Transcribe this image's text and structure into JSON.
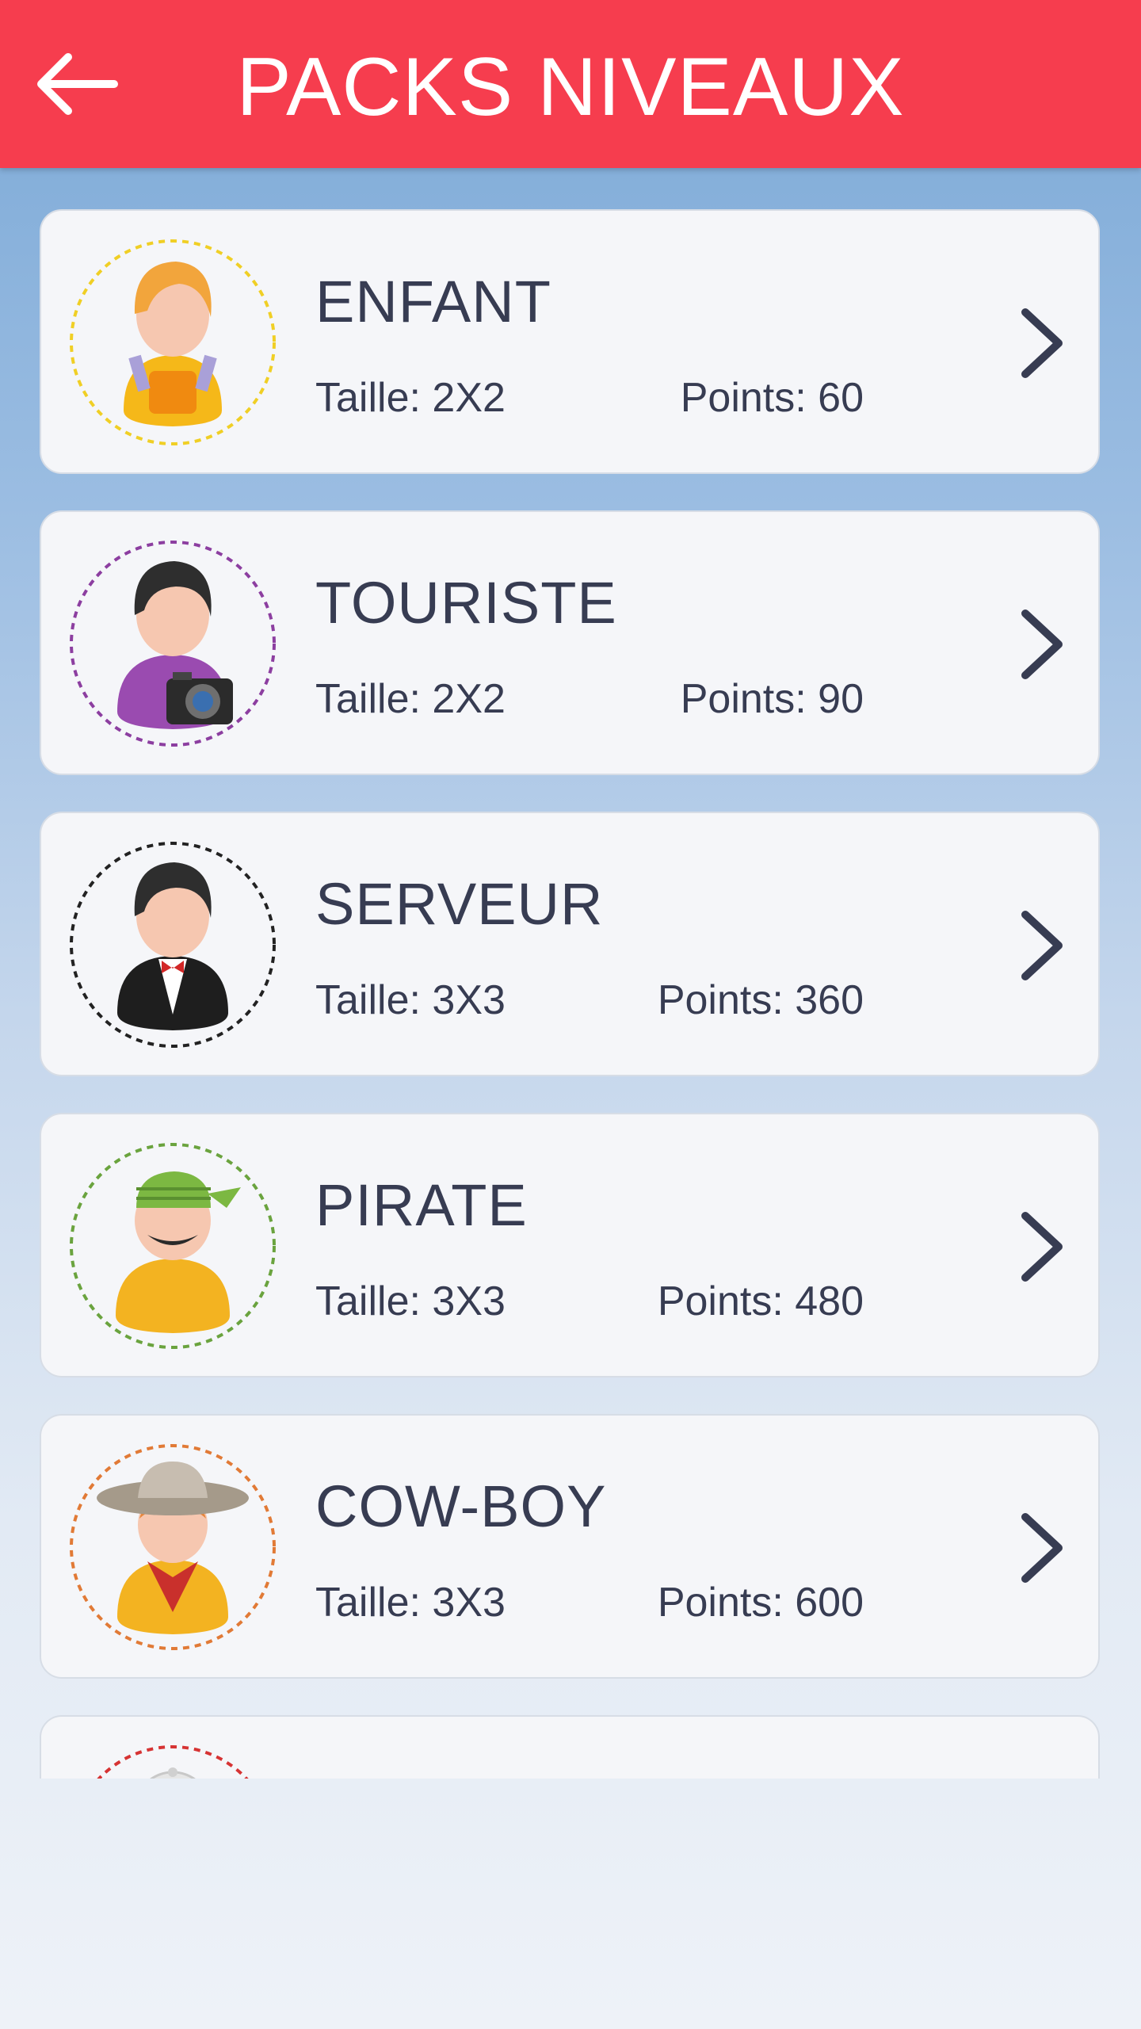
{
  "header": {
    "title": "PACKS NIVEAUX",
    "back_icon": "arrow-left-icon",
    "background_color": "#f63d4e"
  },
  "packs": [
    {
      "name": "ENFANT",
      "size": "Taille: 2X2",
      "points": "Points: 60",
      "avatar": "child-avatar-icon",
      "ring_color": "#f0cf25"
    },
    {
      "name": "TOURISTE",
      "size": "Taille: 2X2",
      "points": "Points: 90",
      "avatar": "tourist-avatar-icon",
      "ring_color": "#8c3ea0"
    },
    {
      "name": "SERVEUR",
      "size": "Taille: 3X3",
      "points": "Points: 360",
      "avatar": "waiter-avatar-icon",
      "ring_color": "#222222"
    },
    {
      "name": "PIRATE",
      "size": "Taille: 3X3",
      "points": "Points: 480",
      "avatar": "pirate-avatar-icon",
      "ring_color": "#6aa33e"
    },
    {
      "name": "COW-BOY",
      "size": "Taille: 3X3",
      "points": "Points: 600",
      "avatar": "cowboy-avatar-icon",
      "ring_color": "#e17a36"
    },
    {
      "name": "",
      "size": "",
      "points": "",
      "avatar": "next-avatar-icon",
      "ring_color": "#d63333"
    }
  ],
  "colors": {
    "text": "#373c52",
    "card": "#f5f6f9"
  }
}
